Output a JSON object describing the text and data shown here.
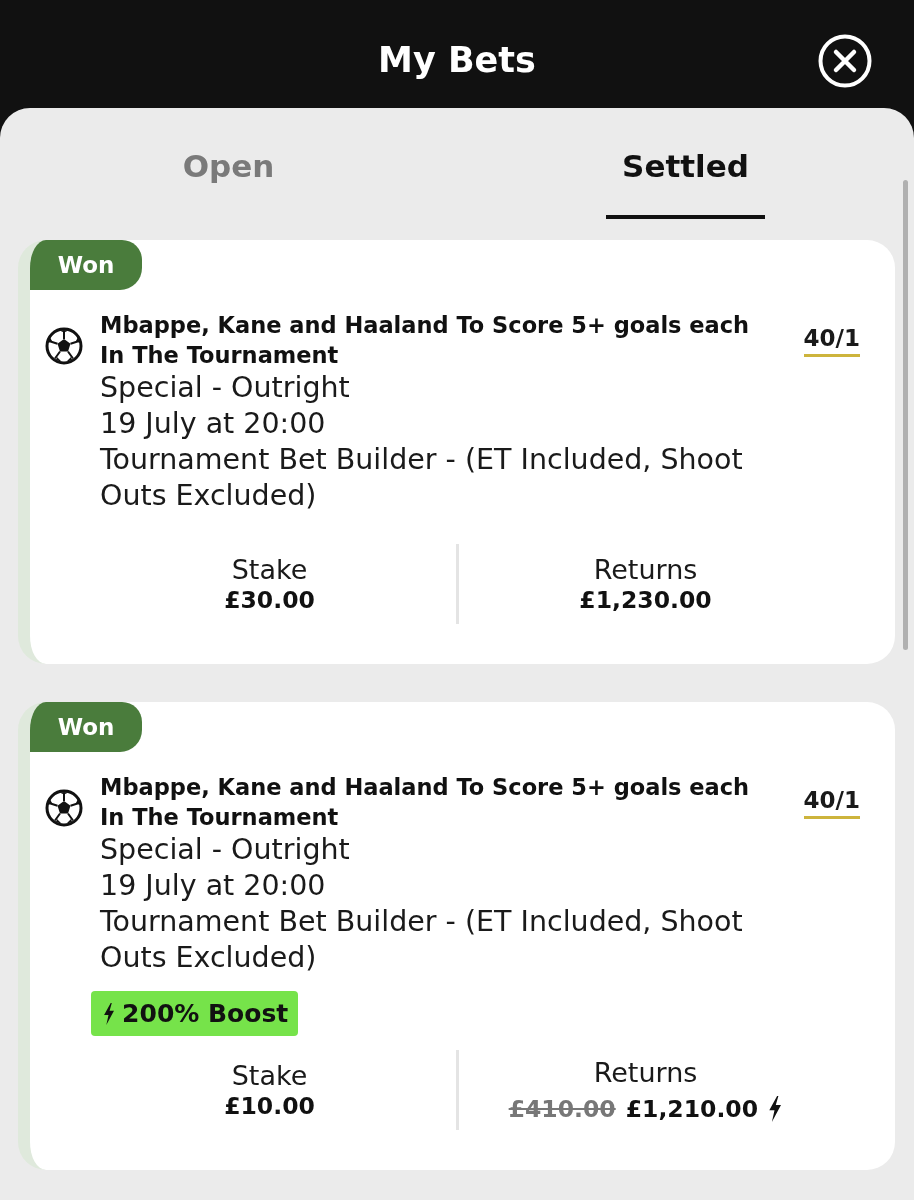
{
  "header": {
    "title": "My Bets"
  },
  "tabs": [
    {
      "label": "Open",
      "selected": false
    },
    {
      "label": "Settled",
      "selected": true
    }
  ],
  "bets": [
    {
      "status": "Won",
      "selection": "Mbappe, Kane and Haaland To Score 5+ goals each In The Tournament",
      "odds": "40/1",
      "market": "Special - Outright",
      "date": "19 July at 20:00",
      "event": "Tournament Bet Builder - (ET Included, Shoot Outs Excluded)",
      "stake_label": "Stake",
      "stake": "£30.00",
      "returns_label": "Returns",
      "returns": "£1,230.00"
    },
    {
      "status": "Won",
      "selection": "Mbappe, Kane and Haaland To Score 5+ goals each In The Tournament",
      "odds": "40/1",
      "market": "Special - Outright",
      "date": "19 July at 20:00",
      "event": "Tournament Bet Builder - (ET Included, Shoot Outs Excluded)",
      "boost": "200% Boost",
      "stake_label": "Stake",
      "stake": "£10.00",
      "returns_label": "Returns",
      "original_returns": "£410.00",
      "returns": "£1,210.00"
    }
  ]
}
